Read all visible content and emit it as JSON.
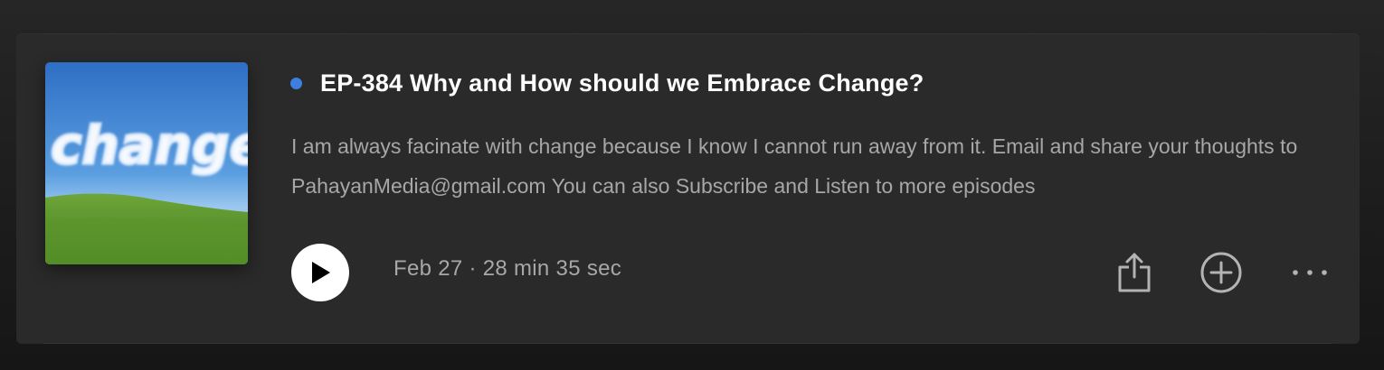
{
  "episode": {
    "title": "EP-384 Why and How should we Embrace Change?",
    "description": "I am always facinate with change because I know I cannot run away from it. Email and share your thoughts to PahayanMedia@gmail.com You can also Subscribe and Listen to more episodes",
    "cover_text": "change",
    "meta": "Feb 27 · 28 min 35 sec",
    "new_indicator_color": "#3d7fe0"
  },
  "icons": {
    "play": "play-icon",
    "share": "share-icon",
    "add": "add-circle-icon",
    "more": "more-horizontal-icon"
  }
}
